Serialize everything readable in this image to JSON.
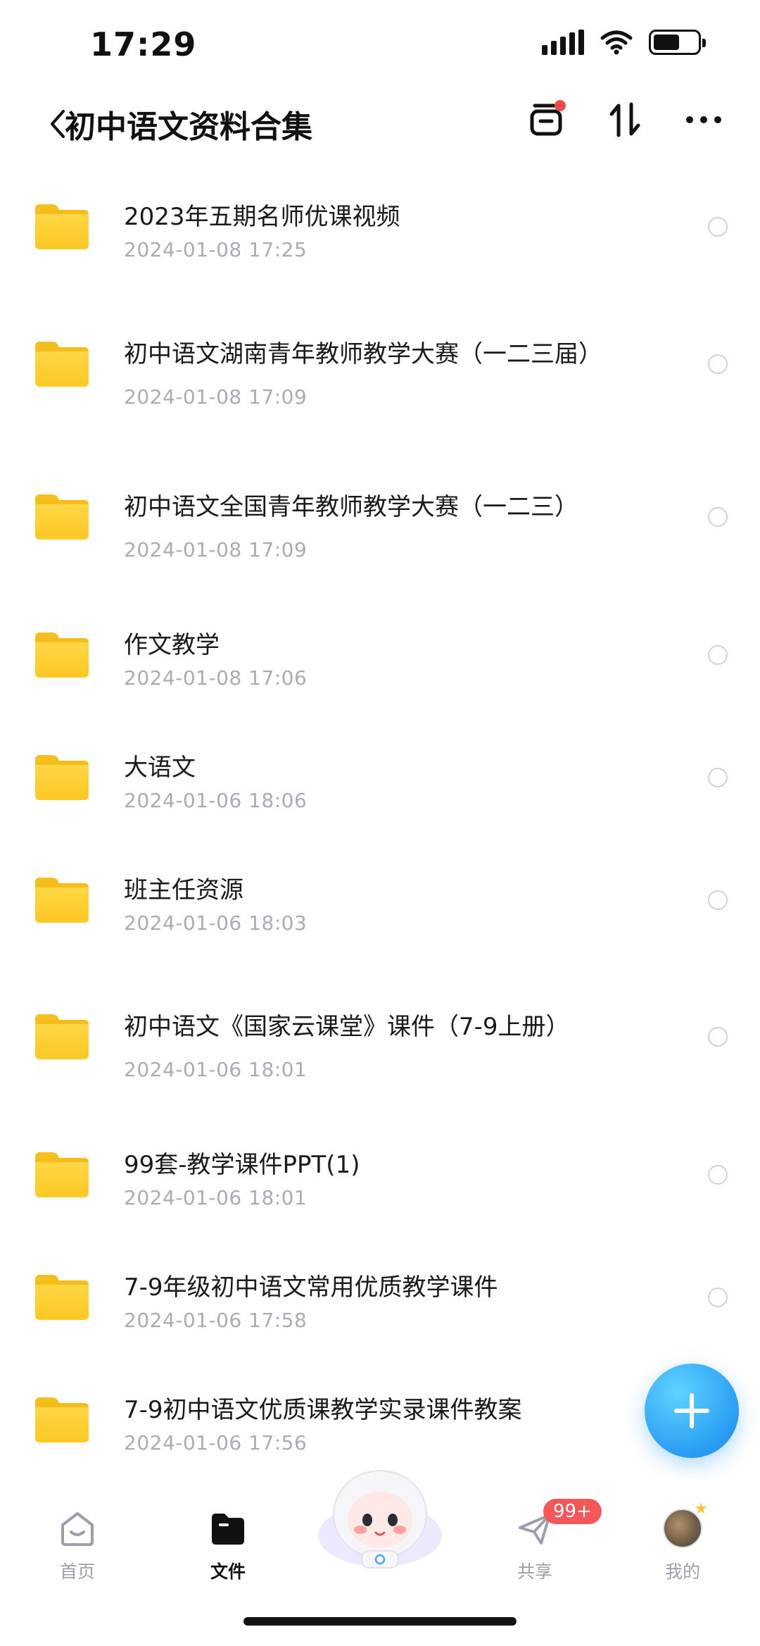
{
  "status_bar": {
    "time": "17:29"
  },
  "header": {
    "title": "初中语文资料合集"
  },
  "files": [
    {
      "name": "2023年五期名师优课视频",
      "date": "2024-01-08 17:25"
    },
    {
      "name": "初中语文湖南青年教师教学大赛（一二三届）",
      "date": "2024-01-08 17:09"
    },
    {
      "name": "初中语文全国青年教师教学大赛（一二三）",
      "date": "2024-01-08 17:09"
    },
    {
      "name": "作文教学",
      "date": "2024-01-08 17:06"
    },
    {
      "name": "大语文",
      "date": "2024-01-06 18:06"
    },
    {
      "name": "班主任资源",
      "date": "2024-01-06 18:03"
    },
    {
      "name": "初中语文《国家云课堂》课件（7-9上册）",
      "date": "2024-01-06 18:01"
    },
    {
      "name": "99套-教学课件PPT(1)",
      "date": "2024-01-06 18:01"
    },
    {
      "name": "7-9年级初中语文常用优质教学课件",
      "date": "2024-01-06 17:58"
    },
    {
      "name": "7-9初中语文优质课教学实录课件教案",
      "date": "2024-01-06 17:56"
    }
  ],
  "nav": {
    "home": "首页",
    "files": "文件",
    "share": "共享",
    "share_badge": "99+",
    "mine": "我的"
  },
  "colors": {
    "accent": "#2a9df4",
    "folder": "#fcc824",
    "badge": "#f25858"
  }
}
